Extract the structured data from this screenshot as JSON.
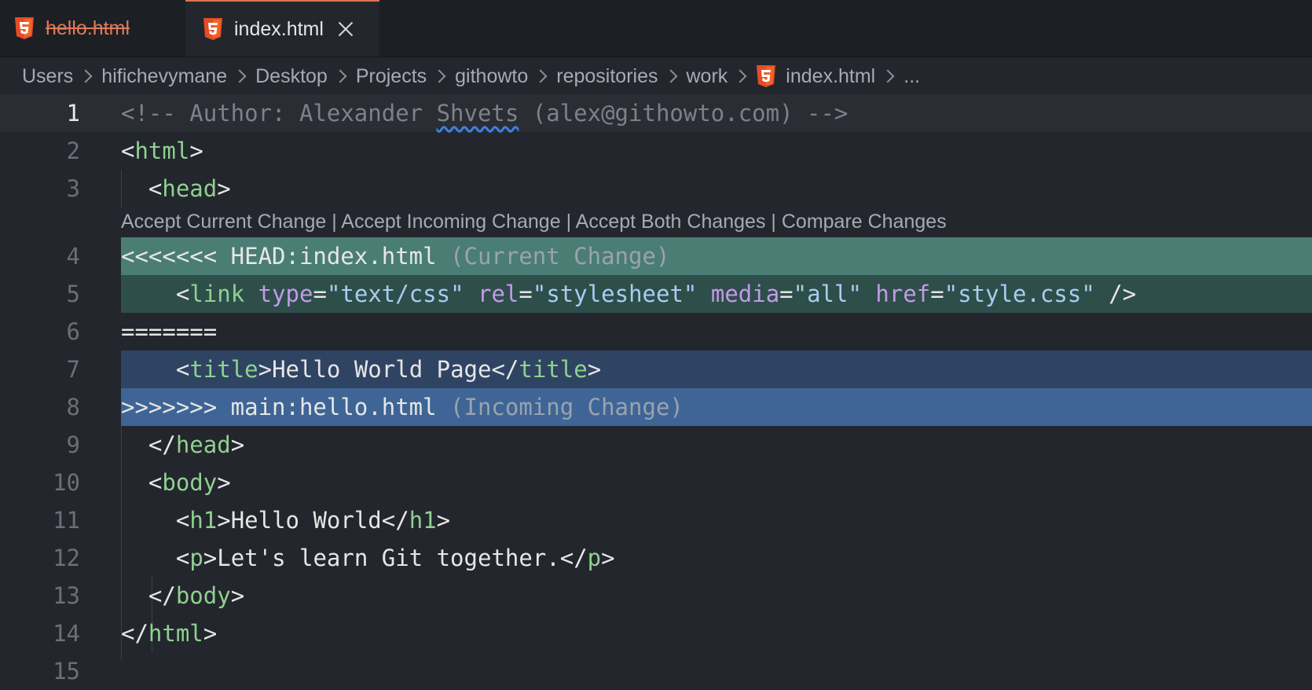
{
  "tabs": [
    {
      "label": "hello.html",
      "icon": "html5-icon",
      "state": "deleted"
    },
    {
      "label": "index.html",
      "icon": "html5-icon",
      "state": "active"
    }
  ],
  "breadcrumbs": [
    "Users",
    "hifichevymane",
    "Desktop",
    "Projects",
    "githowto",
    "repositories",
    "work",
    "index.html",
    "..."
  ],
  "codelens": {
    "accept_current": "Accept Current Change",
    "accept_incoming": "Accept Incoming Change",
    "accept_both": "Accept Both Changes",
    "compare": "Compare Changes",
    "separator": " | "
  },
  "editor": {
    "active_line": 1,
    "line_numbers": [
      "1",
      "2",
      "3",
      "4",
      "5",
      "6",
      "7",
      "8",
      "9",
      "10",
      "11",
      "12",
      "13",
      "14",
      "15"
    ],
    "lines": {
      "l1": "<!-- Author: Alexander Shvets (alex@githowto.com) -->",
      "l4_marker": "<<<<<<< HEAD:index.html",
      "l4_label": "(Current Change)",
      "l6": "=======",
      "l7_text": "Hello World Page",
      "l8_marker": ">>>>>>> main:hello.html",
      "l8_label": "(Incoming Change)",
      "l11_text": "Hello World",
      "l12_text": "Let's learn Git together."
    },
    "tags": {
      "html": "html",
      "head": "head",
      "link": "link",
      "title": "title",
      "body": "body",
      "h1": "h1",
      "p": "p"
    },
    "link_attrs": [
      {
        "name": "type",
        "value": "\"text/css\""
      },
      {
        "name": "rel",
        "value": "\"stylesheet\""
      },
      {
        "name": "media",
        "value": "\"all\""
      },
      {
        "name": "href",
        "value": "\"style.css\""
      }
    ],
    "comment_parts": {
      "before": "<!-- Author: Alexander ",
      "squiggle": "Shvets",
      "after": " (alex@githowto.com) -->"
    }
  },
  "colors": {
    "background": "#23262d",
    "current_change_header": "#4a7d74",
    "current_change": "#2e4e4a",
    "incoming_change": "#2f4463",
    "incoming_change_header": "#3e6596",
    "html5_icon": "#e44d26",
    "tag": "#8fd18f",
    "attribute": "#c39ae8",
    "string": "#a8cdf0"
  }
}
